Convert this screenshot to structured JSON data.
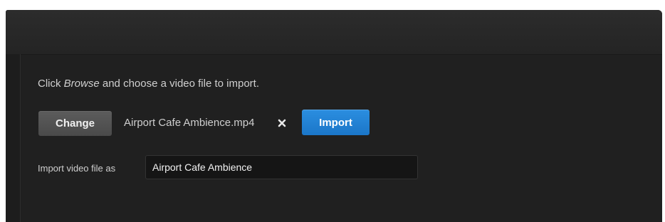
{
  "dialog": {
    "instruction_prefix": "Click ",
    "instruction_emphasis": "Browse",
    "instruction_suffix": " and choose a video file to import.",
    "change_label": "Change",
    "selected_file": "Airport Cafe Ambience.mp4",
    "remove_icon": "close-icon",
    "import_label": "Import",
    "import_as_label": "Import video file as",
    "import_as_value": "Airport Cafe Ambience"
  },
  "colors": {
    "background": "#202020",
    "primary_button": "#1f7fd0",
    "secondary_button": "#535353",
    "text": "#cfcfcf"
  }
}
